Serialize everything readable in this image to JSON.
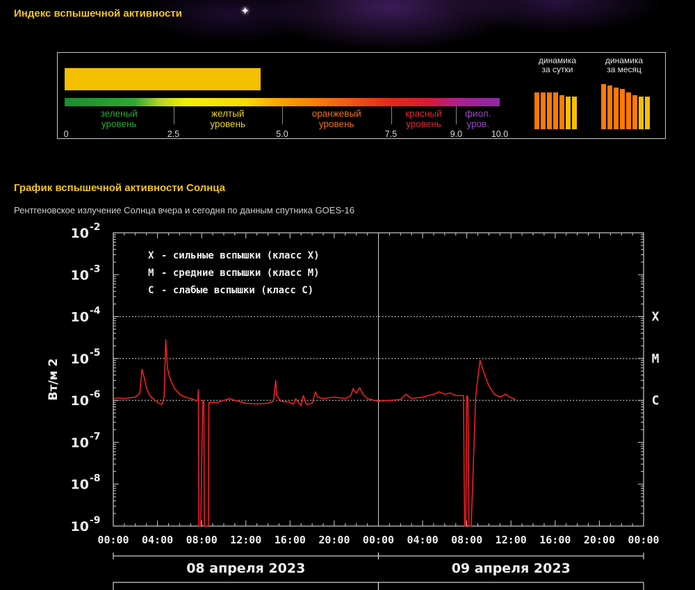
{
  "header": {
    "index_title": "Индекс вспышечной активности",
    "chart_title": "График вспышечной активности Солнца",
    "chart_subtitle": "Рентгеновское излучение Солнца вчера и сегодня по данным спутника GOES-16"
  },
  "index": {
    "current_value": 4.5,
    "scale_min": 0,
    "scale_max": 10,
    "bar_color": "#f5c000",
    "ticks": [
      "0",
      "2.5",
      "5.0",
      "7.5",
      "9.0",
      "10.0"
    ],
    "zones": [
      {
        "line1": "зеленый",
        "line2": "уровень",
        "from": 0,
        "to": 2.5,
        "color": "#2fa83a"
      },
      {
        "line1": "желтый",
        "line2": "уровень",
        "from": 2.5,
        "to": 5.0,
        "color": "#e8d81e"
      },
      {
        "line1": "оранжевый",
        "line2": "уровень",
        "from": 5.0,
        "to": 7.5,
        "color": "#f07020"
      },
      {
        "line1": "красный",
        "line2": "уровень",
        "from": 7.5,
        "to": 9.0,
        "color": "#e02830"
      },
      {
        "line1": "фиол.",
        "line2": "уров.",
        "from": 9.0,
        "to": 10.0,
        "color": "#9a4ac0"
      }
    ]
  },
  "dynamics": {
    "day": {
      "caption_line1": "динамика",
      "caption_line2": "за сутки",
      "levels": [
        5.7,
        5.7,
        5.7,
        5.7,
        5.2,
        5.0,
        5.0
      ],
      "colors": [
        "#ff7a00",
        "#ff7a00",
        "#ff7a00",
        "#ff7a00",
        "#ff7a00",
        "#f5c000",
        "#f5c000"
      ]
    },
    "month": {
      "caption_line1": "динамика",
      "caption_line2": "за месяц",
      "levels": [
        7.0,
        6.7,
        6.4,
        6.2,
        5.7,
        5.2,
        5.0,
        5.0
      ],
      "colors": [
        "#ff7a00",
        "#ff7a00",
        "#ff7a00",
        "#ff7a00",
        "#ff7a00",
        "#ff7a00",
        "#f5c000",
        "#f5c000"
      ]
    }
  },
  "chart_data": {
    "type": "line",
    "ylabel": "Вт/м 2",
    "yscale": "log",
    "ylim": [
      1e-09,
      0.01
    ],
    "ytick_labels": [
      {
        "base": "10",
        "exp": "-2",
        "value": 0.01
      },
      {
        "base": "10",
        "exp": "-3",
        "value": 0.001
      },
      {
        "base": "10",
        "exp": "-4",
        "value": 0.0001
      },
      {
        "base": "10",
        "exp": "-5",
        "value": 1e-05
      },
      {
        "base": "10",
        "exp": "-6",
        "value": 1e-06
      },
      {
        "base": "10",
        "exp": "-7",
        "value": 1e-07
      },
      {
        "base": "10",
        "exp": "-8",
        "value": 1e-08
      },
      {
        "base": "10",
        "exp": "-9",
        "value": 1e-09
      }
    ],
    "xlim_hours": [
      0,
      48
    ],
    "xtick_labels": [
      "00:00",
      "04:00",
      "08:00",
      "12:00",
      "16:00",
      "20:00",
      "00:00",
      "04:00",
      "08:00",
      "12:00",
      "16:00",
      "20:00",
      "00:00"
    ],
    "days": [
      "08 апреля 2023",
      "09 апреля 2023"
    ],
    "class_levels": [
      {
        "label": "X",
        "value": 0.0001
      },
      {
        "label": "M",
        "value": 1e-05
      },
      {
        "label": "C",
        "value": 1e-06
      }
    ],
    "legend": [
      {
        "letter": "X",
        "text": "- сильные вспышки (класс X)"
      },
      {
        "letter": "M",
        "text": "- средние вспышки (класс M)"
      },
      {
        "letter": "C",
        "text": "- слабые вспышки (класс C)"
      }
    ],
    "series": [
      {
        "color": "#ff2020",
        "hours": [
          0,
          0.5,
          1.0,
          1.5,
          2.0,
          2.4,
          2.6,
          2.8,
          3.0,
          3.3,
          3.6,
          4.0,
          4.4,
          4.6,
          4.75,
          4.9,
          5.1,
          5.5,
          6.0,
          6.5,
          7.0,
          7.5,
          7.65,
          7.7,
          7.75,
          7.9,
          8.1,
          8.2,
          8.25,
          8.3,
          8.5,
          8.6,
          8.65,
          8.7,
          8.8,
          9.5,
          10.0,
          10.5,
          11.0,
          12.0,
          13.0,
          14.0,
          14.5,
          14.7,
          14.8,
          15.2,
          16.0,
          16.3,
          16.5,
          17.0,
          17.2,
          17.5,
          18.0,
          18.3,
          18.5,
          19.0,
          20.0,
          21.0,
          21.5,
          21.7,
          22.0,
          22.3,
          22.6,
          23.0,
          24.0,
          25.0,
          26.0,
          26.5,
          27.0,
          28.0,
          29.0,
          29.5,
          30.0,
          30.5,
          31.0,
          31.5,
          31.7,
          31.8,
          31.9,
          32.0,
          32.1,
          32.2,
          32.4,
          32.8,
          33.0,
          33.2,
          33.5,
          34.0,
          34.5,
          35.0,
          35.5,
          36.0,
          36.4
        ],
        "values": [
          1.1e-06,
          1.15e-06,
          1.1e-06,
          1.15e-06,
          1.2e-06,
          1.5e-06,
          5.5e-06,
          3.5e-06,
          2e-06,
          1.3e-06,
          1.1e-06,
          9e-07,
          8e-07,
          1.2e-06,
          2.8e-05,
          6e-06,
          3.5e-06,
          2e-06,
          1.4e-06,
          1.2e-06,
          1.1e-06,
          1e-06,
          1e-06,
          1.8e-06,
          1e-09,
          1e-09,
          1e-06,
          9e-07,
          1e-09,
          1e-09,
          1e-09,
          1e-09,
          9e-07,
          8.5e-07,
          9e-07,
          9e-07,
          1e-06,
          1.1e-06,
          1e-06,
          8.5e-07,
          8.2e-07,
          8.5e-07,
          9.5e-07,
          3e-06,
          1.3e-06,
          9.5e-07,
          9e-07,
          8e-07,
          1.1e-06,
          7.5e-07,
          1.3e-06,
          8e-07,
          8.5e-07,
          1.6e-06,
          1.2e-06,
          1.1e-06,
          1.2e-06,
          1.1e-06,
          1.3e-06,
          1.9e-06,
          1.5e-06,
          2e-06,
          1.4e-06,
          1.1e-06,
          9.5e-07,
          1e-06,
          1.05e-06,
          1.4e-06,
          1.1e-06,
          1.2e-06,
          1.4e-06,
          1.6e-06,
          1.4e-06,
          1.5e-06,
          1.3e-06,
          1.3e-06,
          1.3e-06,
          1e-09,
          1e-09,
          1.3e-06,
          1.2e-06,
          1e-09,
          1e-09,
          1.2e-06,
          3.5e-06,
          9e-06,
          5e-06,
          2.2e-06,
          1.4e-06,
          1.2e-06,
          1.4e-06,
          1.15e-06,
          1.05e-06
        ]
      }
    ]
  }
}
